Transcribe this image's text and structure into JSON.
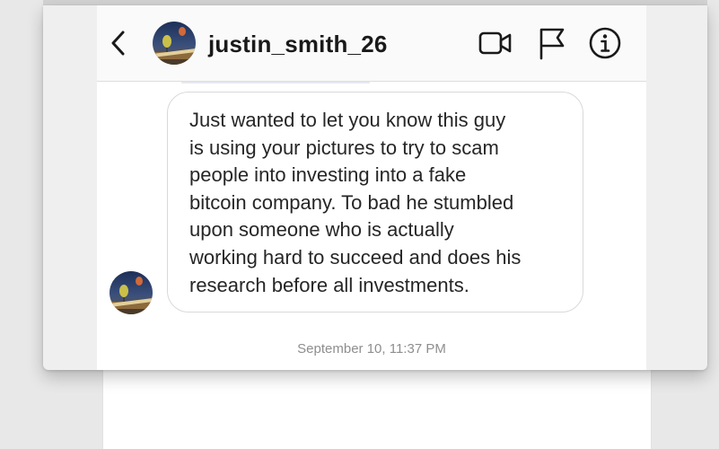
{
  "header": {
    "username": "justin_smith_26",
    "back_icon": "chevron-left",
    "actions": [
      {
        "name": "video-call",
        "icon": "video-camera"
      },
      {
        "name": "report",
        "icon": "flag"
      },
      {
        "name": "info",
        "icon": "info-circle"
      }
    ]
  },
  "conversation": {
    "message": {
      "text": "Just wanted to let you know this guy\nis using your pictures to try to scam\npeople into investing into a fake\nbitcoin company. To bad he stumbled\nupon someone who is actually\nworking hard to succeed and does his\nresearch before all investments."
    },
    "timestamp": "September 10, 11:37 PM"
  },
  "colors": {
    "username": "#1a1a1a",
    "message_text": "#262626",
    "bubble_border": "#d9d9d9",
    "timestamp": "#8e8e8e",
    "header_bg": "#fafafa"
  }
}
